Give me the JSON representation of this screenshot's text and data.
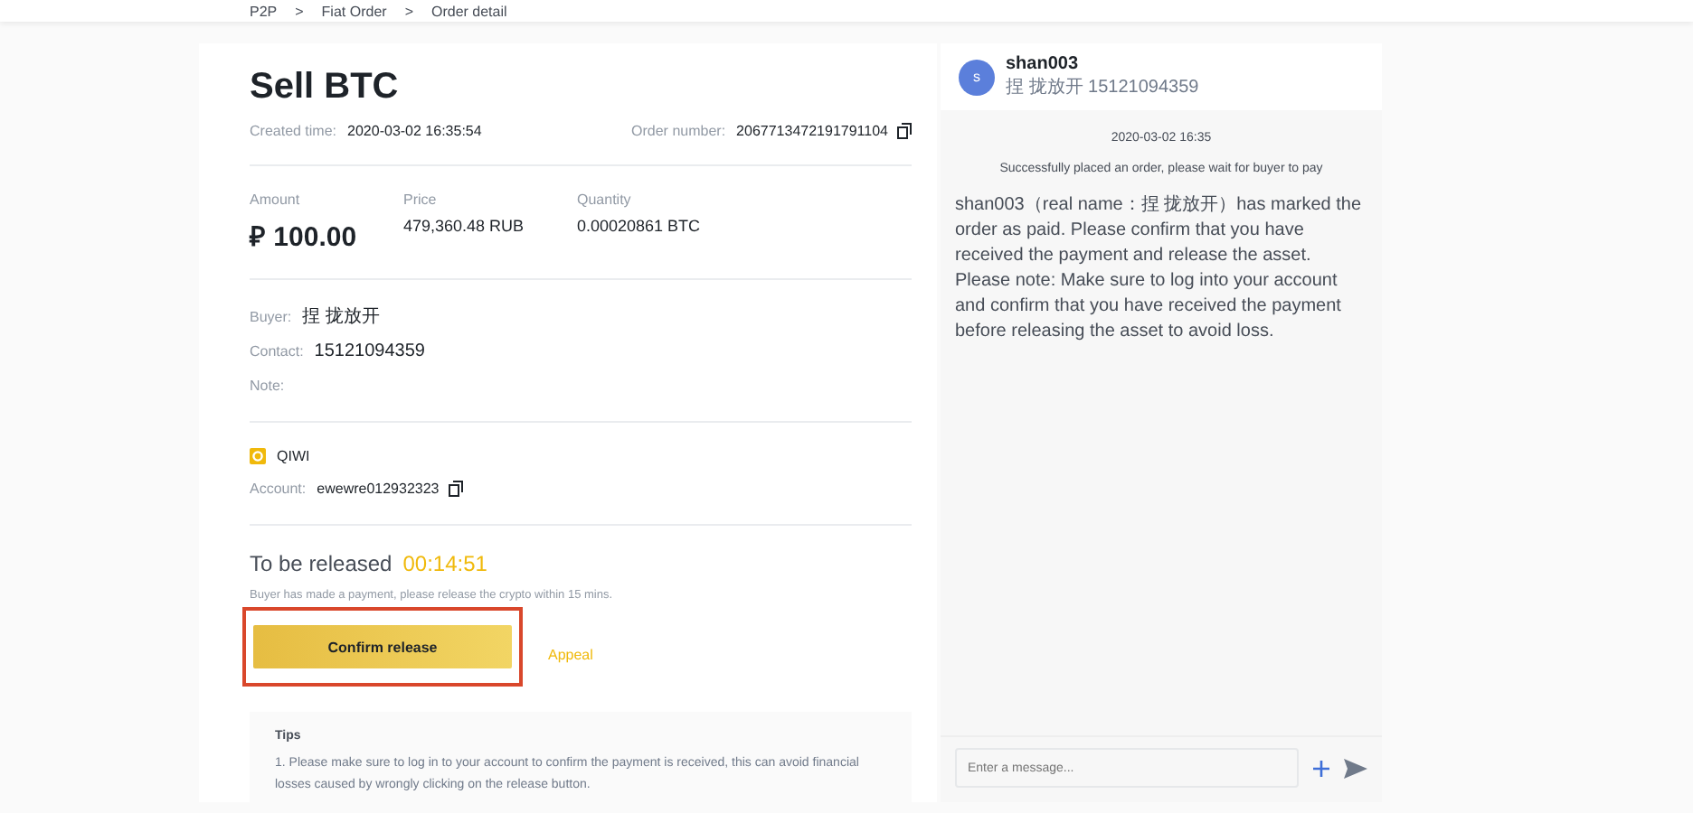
{
  "breadcrumb": {
    "separator": ">",
    "items": [
      "P2P",
      "Fiat Order",
      "Order detail"
    ]
  },
  "order": {
    "title": "Sell BTC",
    "created_label": "Created time:",
    "created_value": "2020-03-02 16:35:54",
    "number_label": "Order number:",
    "number_value": "2067713472191791104"
  },
  "figures": [
    {
      "label": "Amount",
      "value": "₽ 100.00",
      "kind": "big"
    },
    {
      "label": "Price",
      "value": "479,360.48 RUB",
      "kind": "normal"
    },
    {
      "label": "Quantity",
      "value": "0.00020861 BTC",
      "kind": "normal"
    }
  ],
  "buyer": [
    {
      "label": "Buyer:",
      "value": "捏 拢放开"
    },
    {
      "label": "Contact:",
      "value": "15121094359"
    },
    {
      "label": "Note:"
    }
  ],
  "payment": {
    "method": "QIWI",
    "account_label": "Account:",
    "account_value": "ewewre012932323"
  },
  "release": {
    "title": "To be released",
    "timer": "00:14:51",
    "hint": "Buyer has made a payment, please release the crypto within 15 mins.",
    "confirm_button": "Confirm release",
    "appeal_link": "Appeal",
    "highlighted": true
  },
  "tips": {
    "title": "Tips",
    "lines": [
      "1. Please make sure to log in to your account to confirm the payment is received, this can avoid financial losses caused by wrongly clicking on the release button."
    ]
  },
  "chat": {
    "avatar_letter": "s",
    "name": "shan003",
    "subtitle": "捏 拢放开 15121094359",
    "time": "2020-03-02 16:35",
    "system_message": "Successfully placed an order, please wait for buyer to pay",
    "message": "shan003（real name：捏 拢放开）has marked the order as paid. Please confirm that you have received the payment and release the asset. Please note: Make sure to log into your account and confirm that you have received the payment before releasing the asset to avoid loss.",
    "input_placeholder": "Enter a message..."
  }
}
